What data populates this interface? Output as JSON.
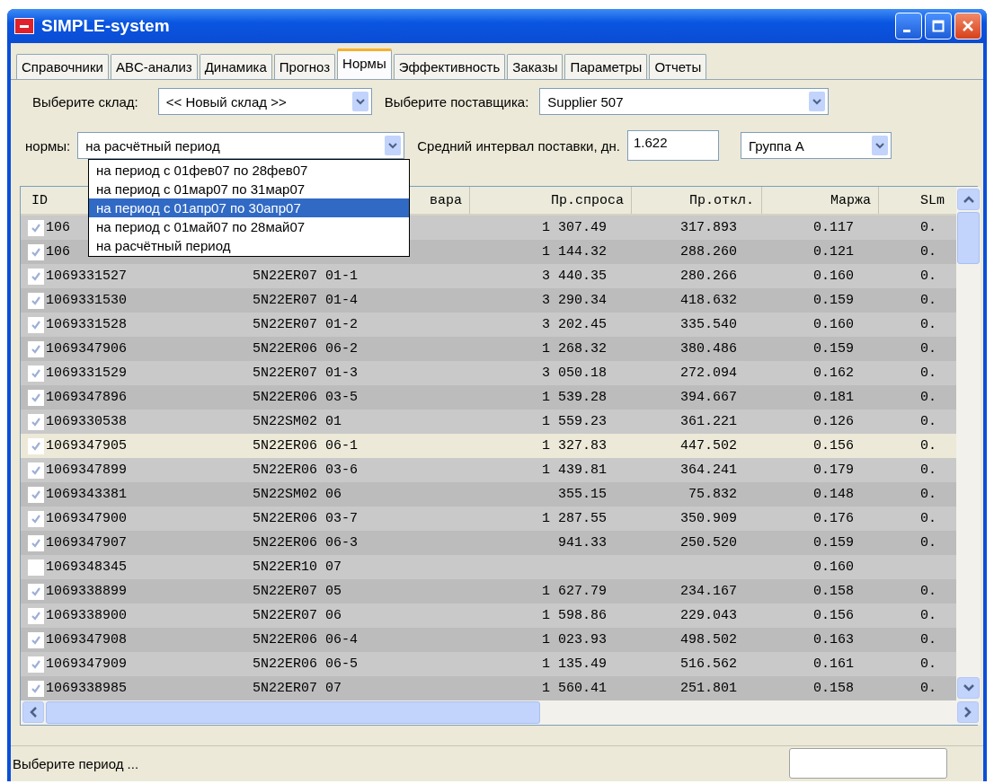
{
  "window": {
    "title": "SIMPLE-system"
  },
  "tabs": [
    {
      "label": "Справочники",
      "selected": false
    },
    {
      "label": "ABC-анализ",
      "selected": false
    },
    {
      "label": "Динамика",
      "selected": false
    },
    {
      "label": "Прогноз",
      "selected": false
    },
    {
      "label": "Нормы",
      "selected": true
    },
    {
      "label": "Эффективность",
      "selected": false
    },
    {
      "label": "Заказы",
      "selected": false
    },
    {
      "label": "Параметры",
      "selected": false
    },
    {
      "label": "Отчеты",
      "selected": false
    }
  ],
  "warehouse": {
    "label": "Выберите склад:",
    "value": "<< Новый склад >>"
  },
  "supplier": {
    "label": "Выберите поставщика:",
    "value": "Supplier 507"
  },
  "norms": {
    "label": "нормы:",
    "value": "на расчётный период"
  },
  "interval": {
    "label": "Средний интервал поставки, дн.",
    "value": "1.622"
  },
  "group": {
    "value": "Группа А"
  },
  "dropdown": {
    "items": [
      {
        "label": "на период с 01фев07 по 28фев07",
        "selected": false
      },
      {
        "label": "на период с 01мар07 по 31мар07",
        "selected": false
      },
      {
        "label": "на период с 01апр07 по 30апр07",
        "selected": true
      },
      {
        "label": "на период с 01май07 по 28май07",
        "selected": false
      },
      {
        "label": "на расчётный период",
        "selected": false
      }
    ]
  },
  "table": {
    "columns": [
      "ID",
      "вара",
      "Пр.спроса",
      "Пр.откл.",
      "Маржа",
      "SLm"
    ],
    "rows": [
      {
        "checked": true,
        "selected": false,
        "cells": [
          "106",
          "",
          "1 307.49",
          "317.893",
          "0.117",
          "0."
        ]
      },
      {
        "checked": true,
        "selected": false,
        "cells": [
          "106",
          "",
          "1 144.32",
          "288.260",
          "0.121",
          "0."
        ]
      },
      {
        "checked": true,
        "selected": false,
        "cells": [
          "1069331527",
          "5N22ER07 01-1",
          "3 440.35",
          "280.266",
          "0.160",
          "0."
        ]
      },
      {
        "checked": true,
        "selected": false,
        "cells": [
          "1069331530",
          "5N22ER07 01-4",
          "3 290.34",
          "418.632",
          "0.159",
          "0."
        ]
      },
      {
        "checked": true,
        "selected": false,
        "cells": [
          "1069331528",
          "5N22ER07 01-2",
          "3 202.45",
          "335.540",
          "0.160",
          "0."
        ]
      },
      {
        "checked": true,
        "selected": false,
        "cells": [
          "1069347906",
          "5N22ER06 06-2",
          "1 268.32",
          "380.486",
          "0.159",
          "0."
        ]
      },
      {
        "checked": true,
        "selected": false,
        "cells": [
          "1069331529",
          "5N22ER07 01-3",
          "3 050.18",
          "272.094",
          "0.162",
          "0."
        ]
      },
      {
        "checked": true,
        "selected": false,
        "cells": [
          "1069347896",
          "5N22ER06 03-5",
          "1 539.28",
          "394.667",
          "0.181",
          "0."
        ]
      },
      {
        "checked": true,
        "selected": false,
        "cells": [
          "1069330538",
          "5N22SM02 01",
          "1 559.23",
          "361.221",
          "0.126",
          "0."
        ]
      },
      {
        "checked": true,
        "selected": true,
        "cells": [
          "1069347905",
          "5N22ER06 06-1",
          "1 327.83",
          "447.502",
          "0.156",
          "0."
        ]
      },
      {
        "checked": true,
        "selected": false,
        "cells": [
          "1069347899",
          "5N22ER06 03-6",
          "1 439.81",
          "364.241",
          "0.179",
          "0."
        ]
      },
      {
        "checked": true,
        "selected": false,
        "cells": [
          "1069343381",
          "5N22SM02 06",
          "355.15",
          "75.832",
          "0.148",
          "0."
        ]
      },
      {
        "checked": true,
        "selected": false,
        "cells": [
          "1069347900",
          "5N22ER06 03-7",
          "1 287.55",
          "350.909",
          "0.176",
          "0."
        ]
      },
      {
        "checked": true,
        "selected": false,
        "cells": [
          "1069347907",
          "5N22ER06 06-3",
          "941.33",
          "250.520",
          "0.159",
          "0."
        ]
      },
      {
        "checked": false,
        "selected": false,
        "cells": [
          "1069348345",
          "5N22ER10 07",
          "",
          "",
          "0.160",
          ""
        ]
      },
      {
        "checked": true,
        "selected": false,
        "cells": [
          "1069338899",
          "5N22ER07 05",
          "1 627.79",
          "234.167",
          "0.158",
          "0."
        ]
      },
      {
        "checked": true,
        "selected": false,
        "cells": [
          "1069338900",
          "5N22ER07 06",
          "1 598.86",
          "229.043",
          "0.156",
          "0."
        ]
      },
      {
        "checked": true,
        "selected": false,
        "cells": [
          "1069347908",
          "5N22ER06 06-4",
          "1 023.93",
          "498.502",
          "0.163",
          "0."
        ]
      },
      {
        "checked": true,
        "selected": false,
        "cells": [
          "1069347909",
          "5N22ER06 06-5",
          "1 135.49",
          "516.562",
          "0.161",
          "0."
        ]
      },
      {
        "checked": true,
        "selected": false,
        "cells": [
          "1069338985",
          "5N22ER07 07",
          "1 560.41",
          "251.801",
          "0.158",
          "0."
        ]
      }
    ]
  },
  "status_bar": {
    "text": "Выберите период ..."
  }
}
